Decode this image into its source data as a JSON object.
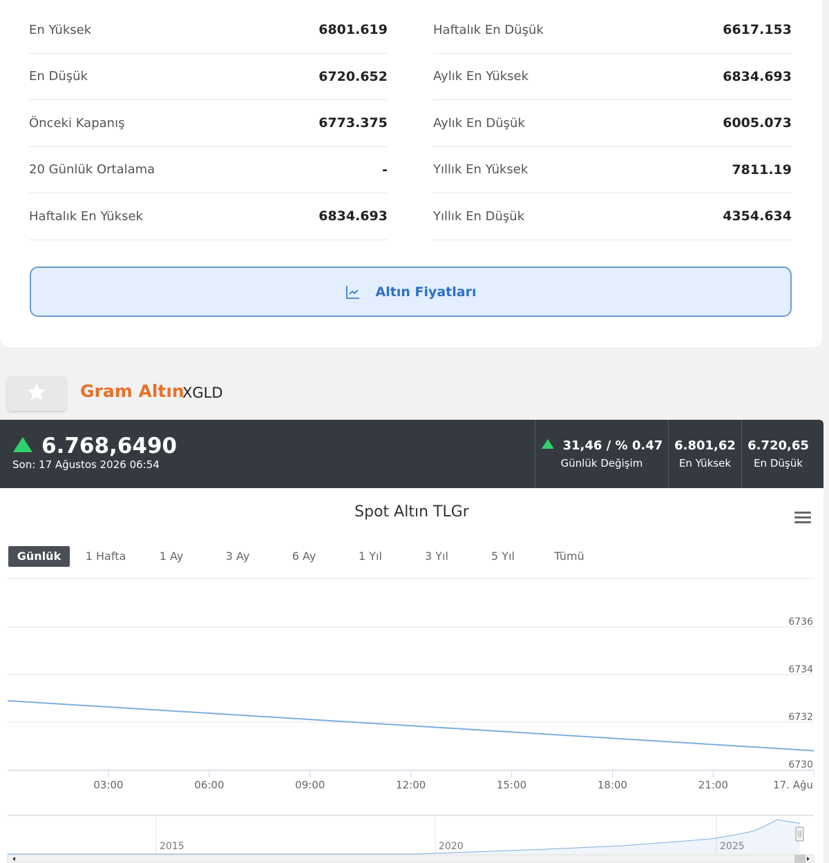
{
  "stats": {
    "left": [
      {
        "label": "En Yüksek",
        "value": "6801.619"
      },
      {
        "label": "En Düşük",
        "value": "6720.652"
      },
      {
        "label": "Önceki Kapanış",
        "value": "6773.375"
      },
      {
        "label": "20 Günlük Ortalama",
        "value": "-"
      },
      {
        "label": "Haftalık En Yüksek",
        "value": "6834.693"
      }
    ],
    "right": [
      {
        "label": "Haftalık En Düşük",
        "value": "6617.153"
      },
      {
        "label": "Aylık En Yüksek",
        "value": "6834.693"
      },
      {
        "label": "Aylık En Düşük",
        "value": "6005.073"
      },
      {
        "label": "Yıllık En Yüksek",
        "value": "7811.19"
      },
      {
        "label": "Yıllık En Düşük",
        "value": "4354.634"
      }
    ]
  },
  "prices_button": {
    "label": "Altın Fiyatları",
    "icon": "line-chart-icon"
  },
  "instrument": {
    "name": "Gram Altın",
    "code": "XGLD",
    "favorite_icon": "star-icon"
  },
  "quote": {
    "price": "6.768,6490",
    "last_update": "Son: 17 Ağustos 2026 06:54",
    "change_value": "31,46 / % 0.47",
    "change_label": "Günlük Değişim",
    "high_value": "6.801,62",
    "high_label": "En Yüksek",
    "low_value": "6.720,65",
    "low_label": "En Düşük",
    "up_color": "#2fd36c"
  },
  "chart_header": {
    "ranges": [
      "Günlük",
      "1 Hafta",
      "1 Ay",
      "3 Ay",
      "6 Ay",
      "1 Yıl",
      "3 Yıl",
      "5 Yıl",
      "Tümü"
    ],
    "active_range": "Günlük",
    "menu_icon": "hamburger-menu-icon"
  },
  "chart_data": {
    "type": "line",
    "title": "Spot Altın TLGr",
    "xlabel": "",
    "ylabel": "",
    "x_ticks": [
      "03:00",
      "06:00",
      "09:00",
      "12:00",
      "15:00",
      "18:00",
      "21:00",
      "17. Ağu"
    ],
    "y_ticks": [
      6730,
      6732,
      6734,
      6736
    ],
    "ylim": [
      6730,
      6737
    ],
    "series": [
      {
        "x": [
          "00:00",
          "24:00"
        ],
        "values": [
          6732.9,
          6730.8
        ]
      }
    ],
    "line_color": "#7eaee0",
    "grid": true,
    "navigator": {
      "year_labels": [
        "2015",
        "2020",
        "2025"
      ]
    }
  }
}
